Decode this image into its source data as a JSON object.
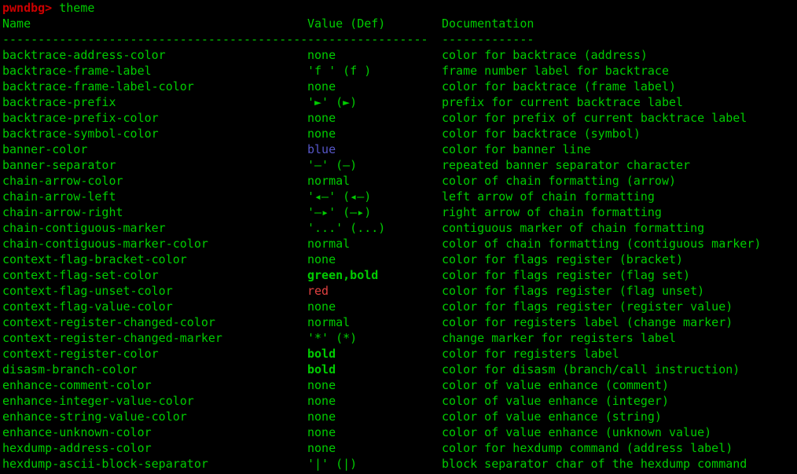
{
  "terminal": {
    "title": "pwndbg theme listing",
    "background_color": "#000000",
    "foreground_color": "#00cc00",
    "prompt_color": "#cc0000",
    "blue_color": "#5656c8",
    "red_color": "#e04040"
  },
  "prompt": {
    "prefix": "pwndbg>",
    "command": "theme"
  },
  "headers": {
    "name": "Name",
    "value": "Value (Def)",
    "documentation": "Documentation"
  },
  "separators": {
    "name": "------------------------------------------------------------------------",
    "value": "-----------------",
    "documentation": "-------------"
  },
  "rows": [
    {
      "name": "backtrace-address-color",
      "value": "none",
      "value_style": "green",
      "doc": "color for backtrace (address)"
    },
    {
      "name": "backtrace-frame-label",
      "value": "'f ' (f )",
      "value_style": "green",
      "doc": "frame number label for backtrace"
    },
    {
      "name": "backtrace-frame-label-color",
      "value": "none",
      "value_style": "green",
      "doc": "color for backtrace (frame label)"
    },
    {
      "name": "backtrace-prefix",
      "value": "'►' (►)",
      "value_style": "green",
      "doc": "prefix for current backtrace label"
    },
    {
      "name": "backtrace-prefix-color",
      "value": "none",
      "value_style": "green",
      "doc": "color for prefix of current backtrace label"
    },
    {
      "name": "backtrace-symbol-color",
      "value": "none",
      "value_style": "green",
      "doc": "color for backtrace (symbol)"
    },
    {
      "name": "banner-color",
      "value": "blue",
      "value_style": "blue",
      "doc": "color for banner line"
    },
    {
      "name": "banner-separator",
      "value": "'—' (—)",
      "value_style": "green",
      "doc": "repeated banner separator character"
    },
    {
      "name": "chain-arrow-color",
      "value": "normal",
      "value_style": "green",
      "doc": "color of chain formatting (arrow)"
    },
    {
      "name": "chain-arrow-left",
      "value": "'◂—' (◂—)",
      "value_style": "green",
      "doc": "left arrow of chain formatting"
    },
    {
      "name": "chain-arrow-right",
      "value": "'—▸' (—▸)",
      "value_style": "green",
      "doc": "right arrow of chain formatting"
    },
    {
      "name": "chain-contiguous-marker",
      "value": "'...' (...)",
      "value_style": "green",
      "doc": "contiguous marker of chain formatting"
    },
    {
      "name": "chain-contiguous-marker-color",
      "value": "normal",
      "value_style": "green",
      "doc": "color of chain formatting (contiguous marker)"
    },
    {
      "name": "context-flag-bracket-color",
      "value": "none",
      "value_style": "green",
      "doc": "color for flags register (bracket)"
    },
    {
      "name": "context-flag-set-color",
      "value": "green,bold",
      "value_style": "green-bold",
      "doc": "color for flags register (flag set)"
    },
    {
      "name": "context-flag-unset-color",
      "value": "red",
      "value_style": "red",
      "doc": "color for flags register (flag unset)"
    },
    {
      "name": "context-flag-value-color",
      "value": "none",
      "value_style": "green",
      "doc": "color for flags register (register value)"
    },
    {
      "name": "context-register-changed-color",
      "value": "normal",
      "value_style": "green",
      "doc": "color for registers label (change marker)"
    },
    {
      "name": "context-register-changed-marker",
      "value": "'*' (*)",
      "value_style": "green",
      "doc": "change marker for registers label"
    },
    {
      "name": "context-register-color",
      "value": "bold",
      "value_style": "green-bold",
      "doc": "color for registers label"
    },
    {
      "name": "disasm-branch-color",
      "value": "bold",
      "value_style": "green-bold",
      "doc": "color for disasm (branch/call instruction)"
    },
    {
      "name": "enhance-comment-color",
      "value": "none",
      "value_style": "green",
      "doc": "color of value enhance (comment)"
    },
    {
      "name": "enhance-integer-value-color",
      "value": "none",
      "value_style": "green",
      "doc": "color of value enhance (integer)"
    },
    {
      "name": "enhance-string-value-color",
      "value": "none",
      "value_style": "green",
      "doc": "color of value enhance (string)"
    },
    {
      "name": "enhance-unknown-color",
      "value": "none",
      "value_style": "green",
      "doc": "color of value enhance (unknown value)"
    },
    {
      "name": "hexdump-address-color",
      "value": "none",
      "value_style": "green",
      "doc": "color for hexdump command (address label)"
    },
    {
      "name": "hexdump-ascii-block-separator",
      "value": "'|' (|)",
      "value_style": "green",
      "doc": "block separator char of the hexdump command"
    }
  ]
}
